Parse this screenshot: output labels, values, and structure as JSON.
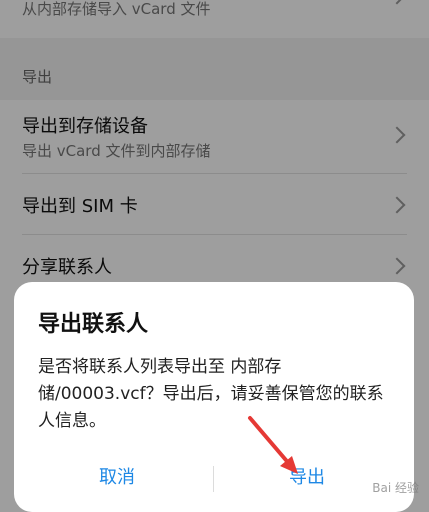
{
  "import_section": {
    "storage_item_subtitle": "从内部存储导入 vCard 文件"
  },
  "export_section": {
    "title": "导出",
    "items": [
      {
        "title": "导出到存储设备",
        "subtitle": "导出 vCard 文件到内部存储"
      },
      {
        "title": "导出到 SIM 卡"
      },
      {
        "title": "分享联系人"
      }
    ]
  },
  "dialog": {
    "title": "导出联系人",
    "message": "是否将联系人列表导出至 内部存储/00003.vcf？导出后，请妥善保管您的联系人信息。",
    "cancel_label": "取消",
    "export_label": "导出",
    "accent_color": "#1e88e5"
  },
  "annotation": {
    "arrow_color": "#e53935"
  },
  "icons": [
    "chevron-right-icon"
  ]
}
